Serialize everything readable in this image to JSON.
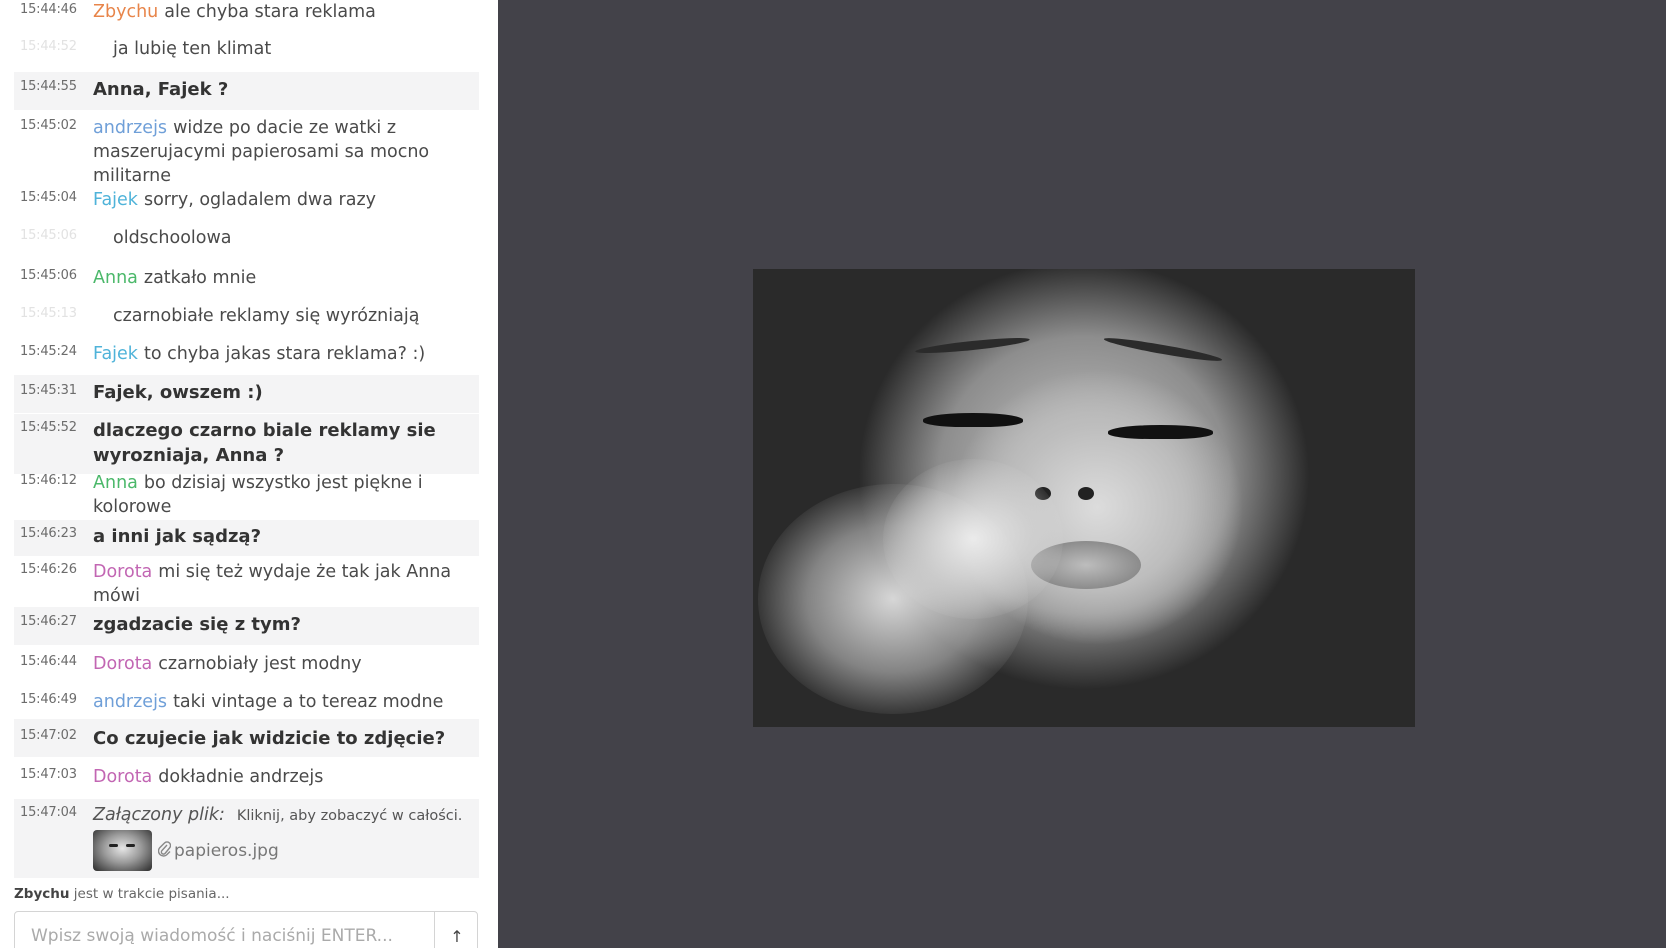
{
  "colors": {
    "zbychu": "#e8854a",
    "andrzejs": "#6f9fd8",
    "fajek": "#4fb3d9",
    "anna": "#4bb86a",
    "dorota": "#c266b3",
    "viewer_background": "#434249"
  },
  "chat": {
    "messages": [
      {
        "time": "15:44:46",
        "author": "Zbychu",
        "text": "ale chyba stara reklama"
      },
      {
        "time": "15:44:52",
        "text": "ja lubię ten klimat"
      },
      {
        "time": "15:44:55",
        "text": "Anna, Fajek ?"
      },
      {
        "time": "15:45:02",
        "author": "andrzejs",
        "text": "widze po dacie ze watki z maszerujacymi papierosami sa mocno militarne"
      },
      {
        "time": "15:45:04",
        "author": "Fajek",
        "text": "sorry, ogladalem dwa razy"
      },
      {
        "time": "15:45:06",
        "text": "oldschoolowa"
      },
      {
        "time": "15:45:06",
        "author": "Anna",
        "text": "zatkało mnie"
      },
      {
        "time": "15:45:13",
        "text": "czarnobiałe reklamy się wyrózniają"
      },
      {
        "time": "15:45:24",
        "author": "Fajek",
        "text": "to chyba jakas stara reklama? :)"
      },
      {
        "time": "15:45:31",
        "text": "Fajek, owszem :)"
      },
      {
        "time": "15:45:52",
        "text": "dlaczego czarno biale reklamy sie wyrozniaja, Anna ?"
      },
      {
        "time": "15:46:12",
        "author": "Anna",
        "text": "bo dzisiaj wszystko jest piękne i kolorowe"
      },
      {
        "time": "15:46:23",
        "text": "a inni jak sądzą?"
      },
      {
        "time": "15:46:26",
        "author": "Dorota",
        "text": "mi się też wydaje że tak jak  Anna mówi"
      },
      {
        "time": "15:46:27",
        "text": "zgadzacie się z tym?"
      },
      {
        "time": "15:46:44",
        "author": "Dorota",
        "text": "czarnobiały jest modny"
      },
      {
        "time": "15:46:49",
        "author": "andrzejs",
        "text": "taki vintage a to tereaz modne"
      },
      {
        "time": "15:47:02",
        "text": "Co czujecie jak widzicie to zdjęcie?"
      },
      {
        "time": "15:47:03",
        "author": "Dorota",
        "text": "dokładnie  andrzejs"
      }
    ],
    "attachment": {
      "time": "15:47:04",
      "label": "Załączony plik:",
      "hint": "Kliknij, aby zobaczyć w całości.",
      "icon": "paperclip-icon",
      "filename": "papieros.jpg"
    },
    "typing": {
      "user": "Zbychu",
      "text": "jest w trakcie pisania..."
    },
    "composer": {
      "placeholder": "Wpisz swoją wiadomość i naciśnij ENTER...",
      "send_icon": "send-arrow-icon",
      "send_glyph": "↑"
    }
  }
}
